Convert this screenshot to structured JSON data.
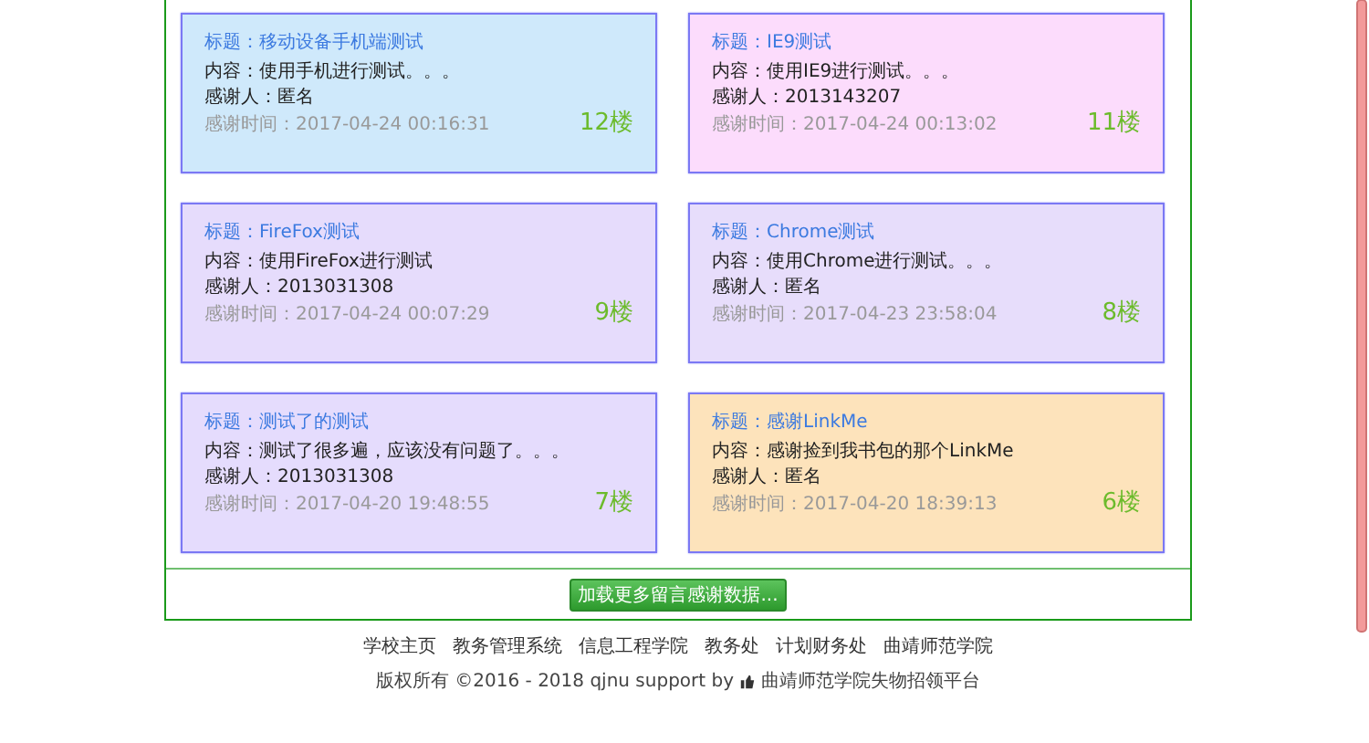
{
  "cards": [
    {
      "title": "标题：移动设备手机端测试",
      "content": "内容：使用手机进行测试。。。",
      "thanker": "感谢人：匿名",
      "time": "感谢时间：2017-04-24 00:16:31",
      "floor": "12楼",
      "color": "#cfe9fb"
    },
    {
      "title": "标题：IE9测试",
      "content": "内容：使用IE9进行测试。。。",
      "thanker": "感谢人：2013143207",
      "time": "感谢时间：2017-04-24 00:13:02",
      "floor": "11楼",
      "color": "#fcdcfc"
    },
    {
      "title": "标题：FireFox测试",
      "content": "内容：使用FireFox进行测试",
      "thanker": "感谢人：2013031308",
      "time": "感谢时间：2017-04-24 00:07:29",
      "floor": "9楼",
      "color": "#e6dcfc"
    },
    {
      "title": "标题：Chrome测试",
      "content": "内容：使用Chrome进行测试。。。",
      "thanker": "感谢人：匿名",
      "time": "感谢时间：2017-04-23 23:58:04",
      "floor": "8楼",
      "color": "#e7ddfb"
    },
    {
      "title": "标题：测试了的测试",
      "content": "内容：测试了很多遍，应该没有问题了。。。",
      "thanker": "感谢人：2013031308",
      "time": "感谢时间：2017-04-20 19:48:55",
      "floor": "7楼",
      "color": "#e5dcfd"
    },
    {
      "title": "标题：感谢LinkMe",
      "content": "内容：感谢捡到我书包的那个LinkMe",
      "thanker": "感谢人：匿名",
      "time": "感谢时间：2017-04-20 18:39:13",
      "floor": "6楼",
      "color": "#fde3bb"
    }
  ],
  "load_more_button": "加载更多留言感谢数据...",
  "footer": {
    "links": [
      "学校主页",
      "教务管理系统",
      "信息工程学院",
      "教务处",
      "计划财务处",
      "曲靖师范学院"
    ],
    "copyright_prefix": "版权所有 ©2016 - 2018 qjnu support by",
    "copyright_site": "曲靖师范学院失物招领平台"
  }
}
